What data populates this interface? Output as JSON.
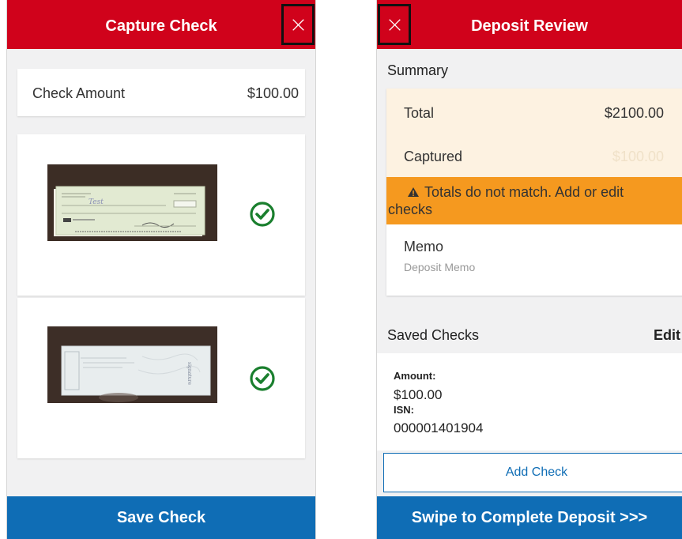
{
  "capture_screen": {
    "header": {
      "title": "Capture Check",
      "close_icon": "close-icon"
    },
    "amount_row": {
      "label": "Check Amount",
      "value": "$100.00"
    },
    "images": [
      {
        "side": "front",
        "status_icon": "check-circle-icon"
      },
      {
        "side": "back",
        "status_icon": "check-circle-icon"
      }
    ],
    "footer": {
      "save_label": "Save Check"
    }
  },
  "review_screen": {
    "header": {
      "title": "Deposit Review",
      "close_icon": "close-icon"
    },
    "summary": {
      "title": "Summary",
      "total_label": "Total",
      "total_value": "$2100.00",
      "captured_label": "Captured",
      "captured_value": "$100.00",
      "warning_icon": "warning-triangle-icon",
      "warning_line1": "Totals do not match. Add or edit",
      "warning_line2": "checks",
      "memo_label": "Memo",
      "memo_placeholder": "Deposit Memo"
    },
    "saved_checks": {
      "title": "Saved Checks",
      "edit_label": "Edit",
      "items": [
        {
          "amount_label": "Amount:",
          "amount": "$100.00",
          "isn_label": "ISN:",
          "isn": "000001401904"
        }
      ]
    },
    "add_check_label": "Add Check",
    "footer": {
      "swipe_label": "Swipe to Complete Deposit >>>"
    }
  },
  "colors": {
    "header_red": "#d0021b",
    "primary_blue": "#0f6db5",
    "warning_orange": "#f5991f",
    "summary_bg": "#fdf2e1",
    "success_green": "#1a7f2e"
  }
}
